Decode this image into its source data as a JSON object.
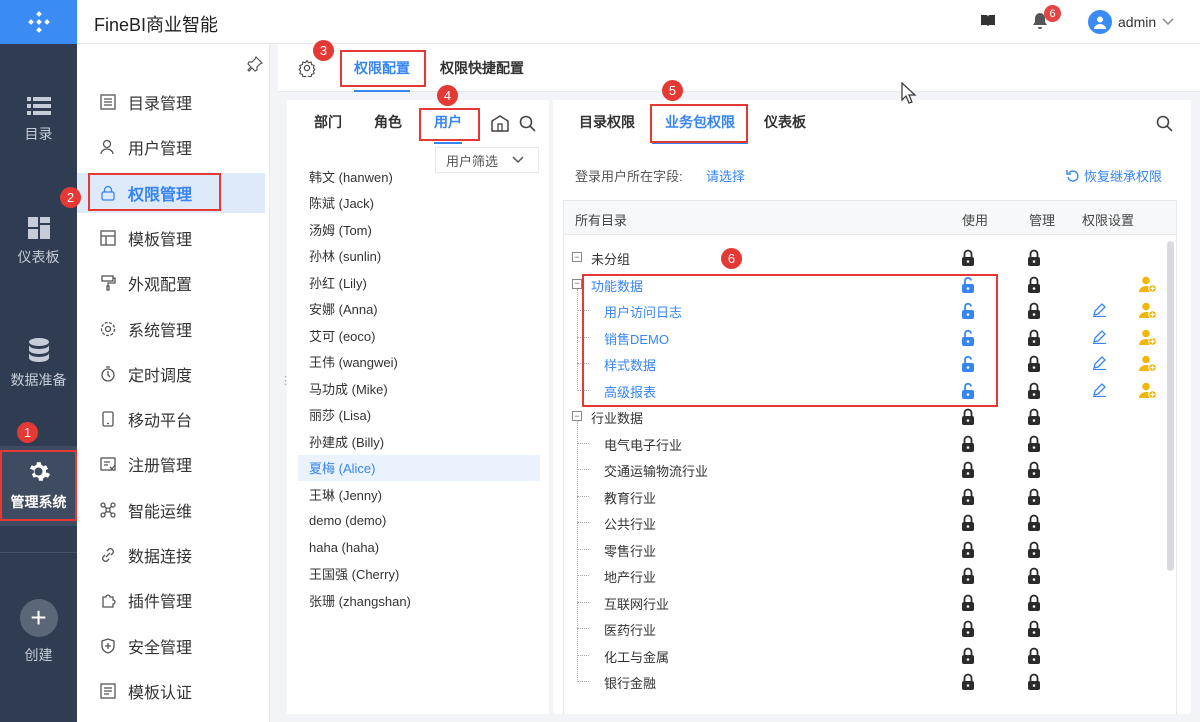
{
  "app": {
    "title": "FineBI商业智能"
  },
  "header": {
    "notification_count": "6",
    "user_name": "admin"
  },
  "rail": {
    "items": [
      {
        "label": "目录",
        "icon": "list-icon"
      },
      {
        "label": "仪表板",
        "icon": "dashboard-icon"
      },
      {
        "label": "数据准备",
        "icon": "database-icon"
      },
      {
        "label": "管理系统",
        "icon": "gear-icon"
      },
      {
        "label": "创建",
        "icon": "plus-icon"
      }
    ]
  },
  "sidebar": {
    "items": [
      {
        "label": "目录管理",
        "icon": "catalog-icon"
      },
      {
        "label": "用户管理",
        "icon": "user-icon"
      },
      {
        "label": "权限管理",
        "icon": "lock-icon"
      },
      {
        "label": "模板管理",
        "icon": "template-icon"
      },
      {
        "label": "外观配置",
        "icon": "brush-icon"
      },
      {
        "label": "系统管理",
        "icon": "settings-icon"
      },
      {
        "label": "定时调度",
        "icon": "timer-icon"
      },
      {
        "label": "移动平台",
        "icon": "mobile-icon"
      },
      {
        "label": "注册管理",
        "icon": "register-icon"
      },
      {
        "label": "智能运维",
        "icon": "ops-icon"
      },
      {
        "label": "数据连接",
        "icon": "link-icon"
      },
      {
        "label": "插件管理",
        "icon": "plugin-icon"
      },
      {
        "label": "安全管理",
        "icon": "shield-icon"
      },
      {
        "label": "模板认证",
        "icon": "certify-icon"
      }
    ]
  },
  "main": {
    "tabs": [
      {
        "label": "权限配置"
      },
      {
        "label": "权限快捷配置"
      }
    ]
  },
  "left_panel": {
    "tabs": [
      "部门",
      "角色",
      "用户"
    ],
    "filter_label": "用户筛选",
    "users": [
      "韩文 (hanwen)",
      "陈斌 (Jack)",
      "汤姆 (Tom)",
      "孙林 (sunlin)",
      "孙红 (Lily)",
      "安娜 (Anna)",
      "艾可 (eoco)",
      "王伟 (wangwei)",
      "马功成 (Mike)",
      "丽莎 (Lisa)",
      "孙建成 (Billy)",
      "夏梅 (Alice)",
      "王琳 (Jenny)",
      "demo (demo)",
      "haha (haha)",
      "王国强 (Cherry)",
      "张珊 (zhangshan)"
    ]
  },
  "right_panel": {
    "tabs": [
      "目录权限",
      "业务包权限",
      "仪表板"
    ],
    "field_label": "登录用户所在字段:",
    "field_link": "请选择",
    "restore_label": "恢复继承权限",
    "table": {
      "headers": [
        "所有目录",
        "使用",
        "管理",
        "权限设置"
      ],
      "rows": [
        {
          "name": "未分组",
          "level": 0
        },
        {
          "name": "功能数据",
          "level": 0
        },
        {
          "name": "用户访问日志",
          "level": 1
        },
        {
          "name": "销售DEMO",
          "level": 1
        },
        {
          "name": "样式数据",
          "level": 1
        },
        {
          "name": "高级报表",
          "level": 1
        },
        {
          "name": "行业数据",
          "level": 0
        },
        {
          "name": "电气电子行业",
          "level": 1
        },
        {
          "name": "交通运输物流行业",
          "level": 1
        },
        {
          "name": "教育行业",
          "level": 1
        },
        {
          "name": "公共行业",
          "level": 1
        },
        {
          "name": "零售行业",
          "level": 1
        },
        {
          "name": "地产行业",
          "level": 1
        },
        {
          "name": "互联网行业",
          "level": 1
        },
        {
          "name": "医药行业",
          "level": 1
        },
        {
          "name": "化工与金属",
          "level": 1
        },
        {
          "name": "银行金融",
          "level": 1
        }
      ]
    }
  },
  "callouts": [
    "1",
    "2",
    "3",
    "4",
    "5",
    "6"
  ],
  "colors": {
    "accent": "#3685f2",
    "rail": "#2f3c51",
    "callout": "#e53935",
    "gold": "#f2b705"
  }
}
